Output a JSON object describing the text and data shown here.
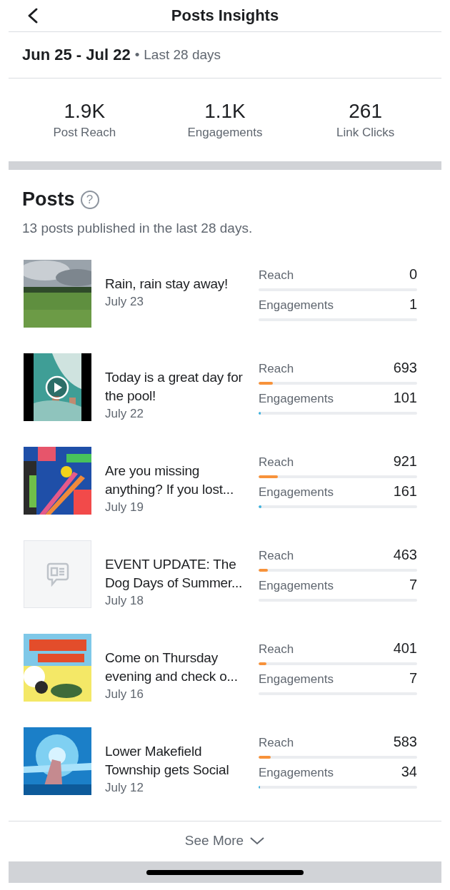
{
  "header": {
    "title": "Posts Insights"
  },
  "date_range": {
    "range": "Jun 25 - Jul 22",
    "separator": "•",
    "period": "Last 28 days"
  },
  "stats": [
    {
      "value": "1.9K",
      "label": "Post Reach"
    },
    {
      "value": "1.1K",
      "label": "Engagements"
    },
    {
      "value": "261",
      "label": "Link Clicks"
    }
  ],
  "posts_section": {
    "title": "Posts",
    "help": "?",
    "subtitle": "13 posts published in the last 28 days."
  },
  "posts": [
    {
      "thumbnail": {
        "kind": "picture",
        "video": false
      },
      "text": "Rain, rain stay away!",
      "date": "July 23",
      "metrics": [
        {
          "kind": "reach",
          "label": "Reach",
          "value": "0",
          "level": 0
        },
        {
          "kind": "engagement",
          "label": "Engagements",
          "value": "1",
          "level": 0
        }
      ]
    },
    {
      "thumbnail": {
        "kind": "picture",
        "video": true
      },
      "text": "Today is a great day for the pool!",
      "date": "July 22",
      "metrics": [
        {
          "kind": "reach",
          "label": "Reach",
          "value": "693",
          "level": 0.09
        },
        {
          "kind": "engagement",
          "label": "Engagements",
          "value": "101",
          "level": 0.015
        }
      ]
    },
    {
      "thumbnail": {
        "kind": "picture",
        "video": false
      },
      "text": "Are you missing anything? If you lost...",
      "date": "July 19",
      "metrics": [
        {
          "kind": "reach",
          "label": "Reach",
          "value": "921",
          "level": 0.12
        },
        {
          "kind": "engagement",
          "label": "Engagements",
          "value": "161",
          "level": 0.02
        }
      ]
    },
    {
      "thumbnail": {
        "kind": "text-post",
        "video": false
      },
      "text": "EVENT UPDATE: The Dog Days of Summer...",
      "date": "July 18",
      "metrics": [
        {
          "kind": "reach",
          "label": "Reach",
          "value": "463",
          "level": 0.06
        },
        {
          "kind": "engagement",
          "label": "Engagements",
          "value": "7",
          "level": 0
        }
      ]
    },
    {
      "thumbnail": {
        "kind": "picture",
        "video": false
      },
      "text": "Come on Thursday evening and check o...",
      "date": "July 16",
      "metrics": [
        {
          "kind": "reach",
          "label": "Reach",
          "value": "401",
          "level": 0.05
        },
        {
          "kind": "engagement",
          "label": "Engagements",
          "value": "7",
          "level": 0
        }
      ]
    },
    {
      "thumbnail": {
        "kind": "picture",
        "video": false
      },
      "text": "Lower Makefield Township gets Social",
      "date": "July 12",
      "metrics": [
        {
          "kind": "reach",
          "label": "Reach",
          "value": "583",
          "level": 0.075
        },
        {
          "kind": "engagement",
          "label": "Engagements",
          "value": "34",
          "level": 0.005
        }
      ]
    }
  ],
  "footer": {
    "see_more": "See More"
  }
}
